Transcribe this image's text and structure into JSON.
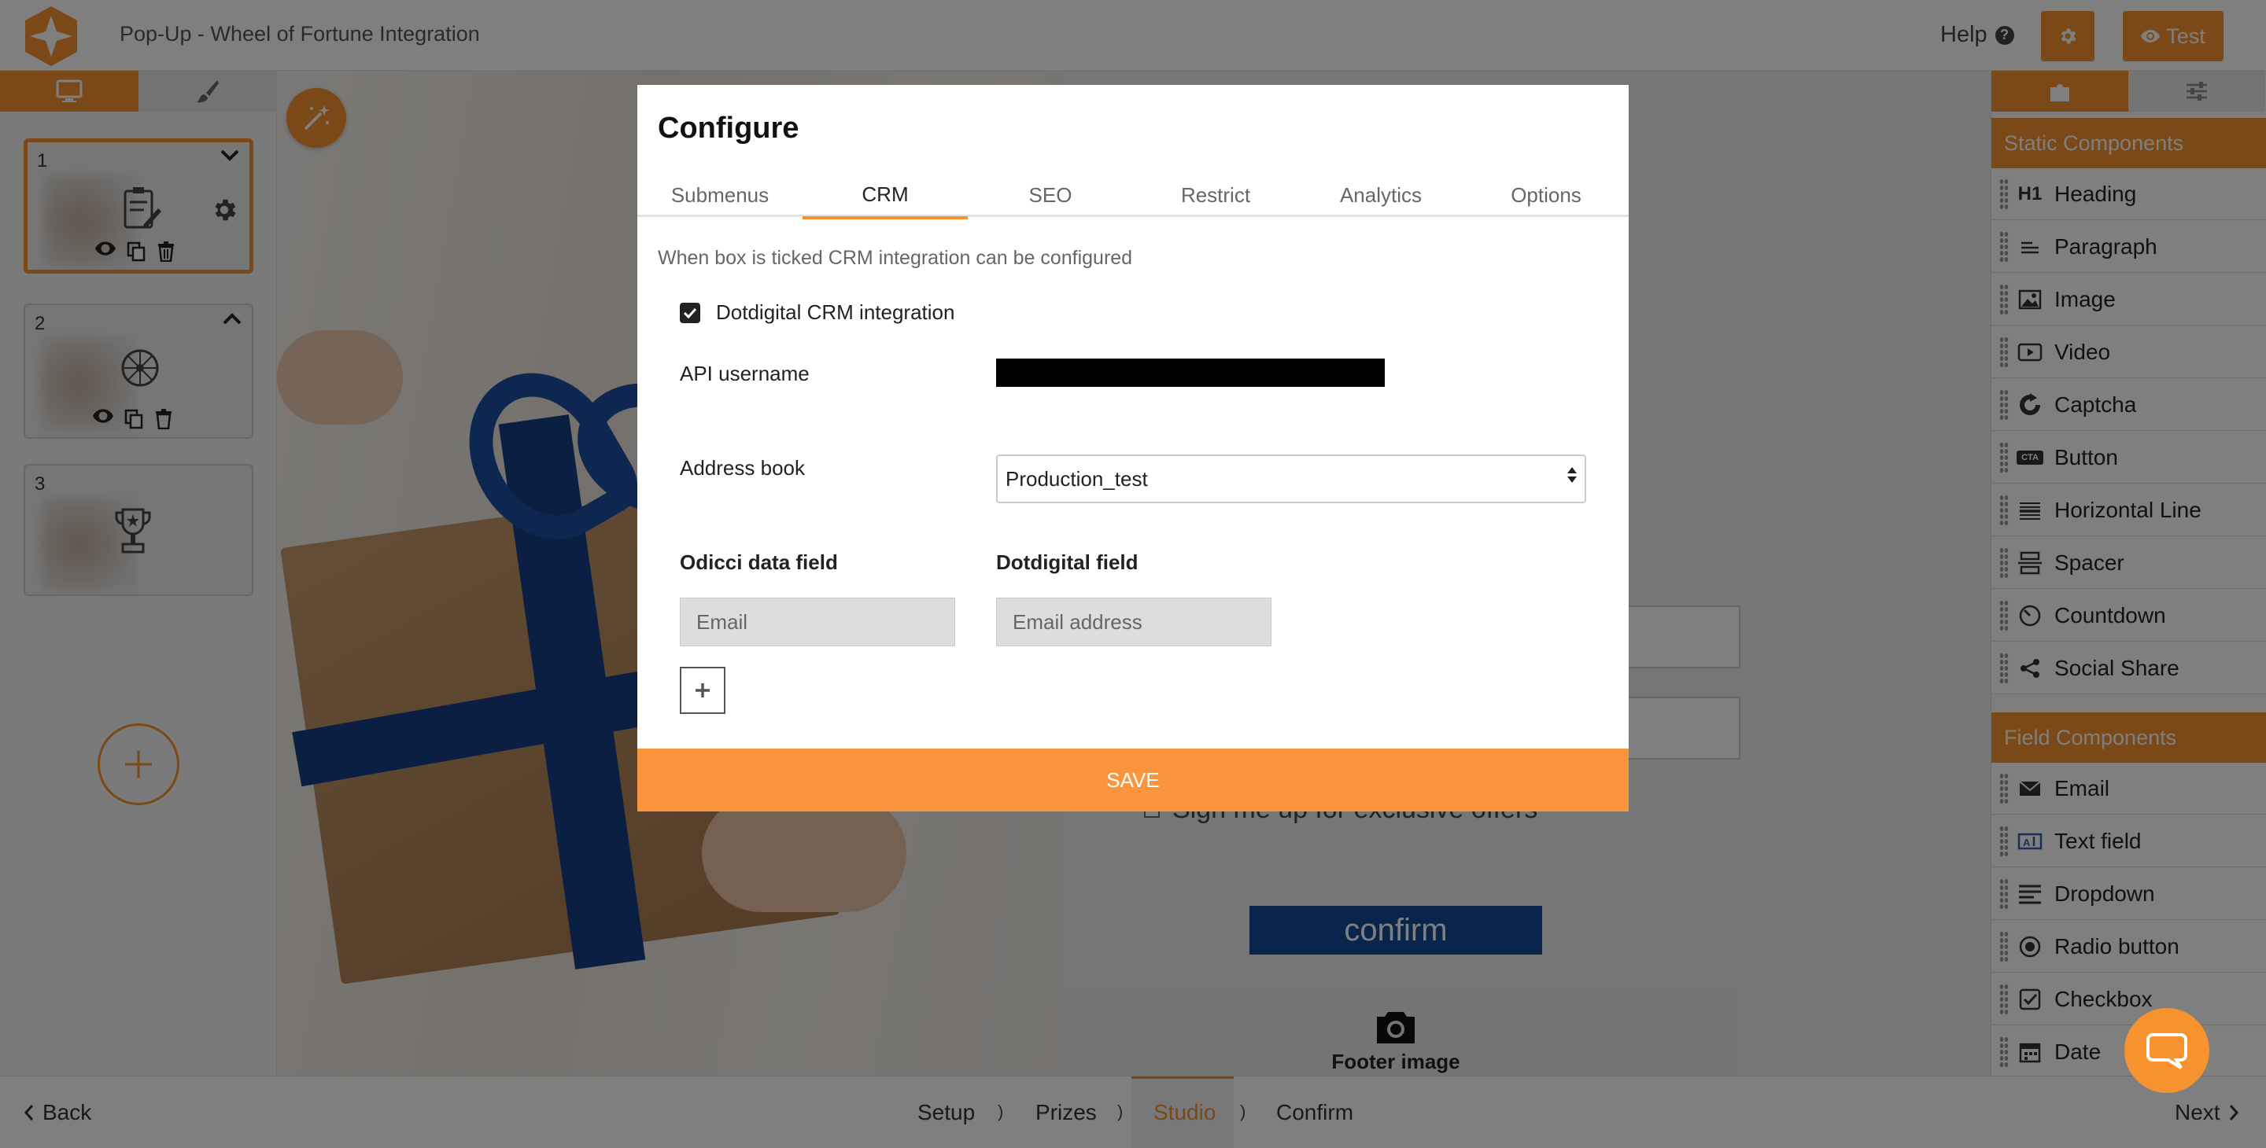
{
  "header": {
    "app_title": "Pop-Up - Wheel of Fortune Integration",
    "help_label": "Help",
    "test_label": "Test",
    "brand_color": "#f7932e"
  },
  "left_panel": {
    "pages": [
      {
        "number": "1"
      },
      {
        "number": "2"
      },
      {
        "number": "3"
      }
    ]
  },
  "canvas": {
    "signup_text": "Sign me up for exclusive offers",
    "confirm_label": "confirm",
    "footer_image_label": "Footer image"
  },
  "right_panel": {
    "static_header": "Static Components",
    "static_items": [
      {
        "label": "Heading",
        "icon": "H1"
      },
      {
        "label": "Paragraph",
        "icon": "paragraph-icon"
      },
      {
        "label": "Image",
        "icon": "image-icon"
      },
      {
        "label": "Video",
        "icon": "video-icon"
      },
      {
        "label": "Captcha",
        "icon": "captcha-icon"
      },
      {
        "label": "Button",
        "icon": "CTA"
      },
      {
        "label": "Horizontal Line",
        "icon": "horizontal-line-icon"
      },
      {
        "label": "Spacer",
        "icon": "spacer-icon"
      },
      {
        "label": "Countdown",
        "icon": "countdown-icon"
      },
      {
        "label": "Social Share",
        "icon": "share-icon"
      }
    ],
    "field_header": "Field Components",
    "field_items": [
      {
        "label": "Email",
        "icon": "envelope-icon"
      },
      {
        "label": "Text field",
        "icon": "text-field-icon"
      },
      {
        "label": "Dropdown",
        "icon": "dropdown-icon"
      },
      {
        "label": "Radio button",
        "icon": "radio-icon"
      },
      {
        "label": "Checkbox",
        "icon": "checkbox-icon"
      },
      {
        "label": "Date",
        "icon": "calendar-icon"
      }
    ]
  },
  "footer_nav": {
    "back": "Back",
    "next": "Next",
    "steps": [
      "Setup",
      "Prizes",
      "Studio",
      "Confirm"
    ],
    "current_step": "Studio"
  },
  "modal": {
    "title": "Configure",
    "tabs": [
      "Submenus",
      "CRM",
      "SEO",
      "Restrict",
      "Analytics",
      "Options"
    ],
    "active_tab": "CRM",
    "hint": "When box is ticked CRM integration can be configured",
    "crm_checkbox_label": "Dotdigital CRM integration",
    "crm_checked": true,
    "api_username_label": "API username",
    "address_book_label": "Address book",
    "address_book_value": "Production_test",
    "col_source": "Odicci data field",
    "col_target": "Dotdigital field",
    "source_field": "Email",
    "target_field": "Email address",
    "save_label": "SAVE"
  }
}
